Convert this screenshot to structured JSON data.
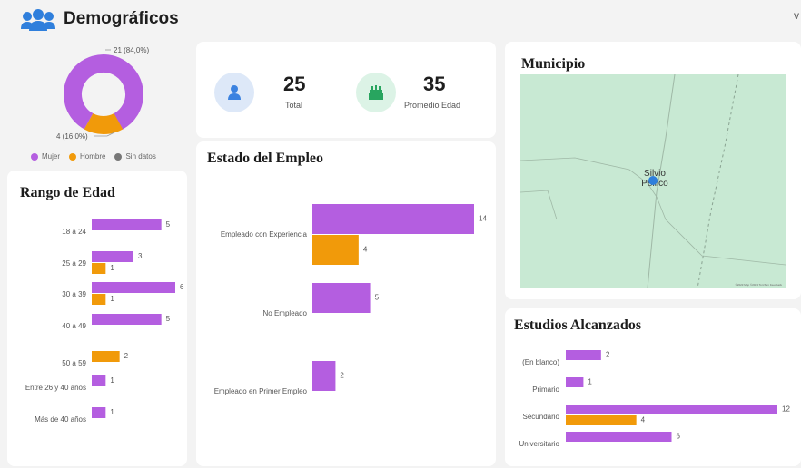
{
  "header": {
    "title": "Demográficos",
    "corner_mark": "v"
  },
  "colors": {
    "mujer": "#b45ee0",
    "hombre": "#f19a0a",
    "sin_datos": "#777777",
    "map": "#c8e9d3"
  },
  "gender": {
    "slices": [
      {
        "label": "Mujer",
        "value": 21,
        "pct": 84.0,
        "callout": "21 (84,0%)"
      },
      {
        "label": "Hombre",
        "value": 4,
        "pct": 16.0,
        "callout": "4 (16,0%)"
      }
    ],
    "legend": [
      "Mujer",
      "Hombre",
      "Sin datos"
    ]
  },
  "kpis": {
    "total": {
      "value": "25",
      "label": "Total",
      "icon": "person-icon"
    },
    "age": {
      "value": "35",
      "label": "Promedio Edad",
      "icon": "cake-icon"
    }
  },
  "municipio": {
    "title": "Municipio",
    "place_line1": "Silvio",
    "place_line2": "Pellico",
    "attribution": "©2023 Map ©2023 TomTom Feedback"
  },
  "rango_edad": {
    "title": "Rango de Edad"
  },
  "empleo": {
    "title": "Estado del Empleo"
  },
  "estudios": {
    "title": "Estudios Alcanzados"
  },
  "chart_data": [
    {
      "type": "pie",
      "categories": [
        "Mujer",
        "Hombre"
      ],
      "values": [
        21,
        4
      ],
      "legend": [
        "Mujer",
        "Hombre",
        "Sin datos"
      ]
    },
    {
      "type": "bar",
      "title": "Rango de Edad",
      "categories": [
        "18 a 24",
        "25 a 29",
        "30 a 39",
        "40 a 49",
        "50 a 59",
        "Entre 26 y 40 años",
        "Más de 40 años"
      ],
      "series": [
        {
          "name": "Mujer",
          "values": [
            5,
            3,
            6,
            5,
            null,
            1,
            1
          ]
        },
        {
          "name": "Hombre",
          "values": [
            null,
            1,
            1,
            null,
            2,
            null,
            null
          ]
        }
      ]
    },
    {
      "type": "bar",
      "title": "Estado del Empleo",
      "categories": [
        "Empleado con Experiencia",
        "No Empleado",
        "Empleado en Primer Empleo"
      ],
      "series": [
        {
          "name": "Mujer",
          "values": [
            14,
            5,
            2
          ]
        },
        {
          "name": "Hombre",
          "values": [
            4,
            null,
            null
          ]
        }
      ]
    },
    {
      "type": "bar",
      "title": "Estudios Alcanzados",
      "categories": [
        "(En blanco)",
        "Primario",
        "Secundario",
        "Universitario"
      ],
      "series": [
        {
          "name": "Mujer",
          "values": [
            2,
            1,
            12,
            6
          ]
        },
        {
          "name": "Hombre",
          "values": [
            null,
            null,
            4,
            null
          ]
        }
      ]
    }
  ]
}
